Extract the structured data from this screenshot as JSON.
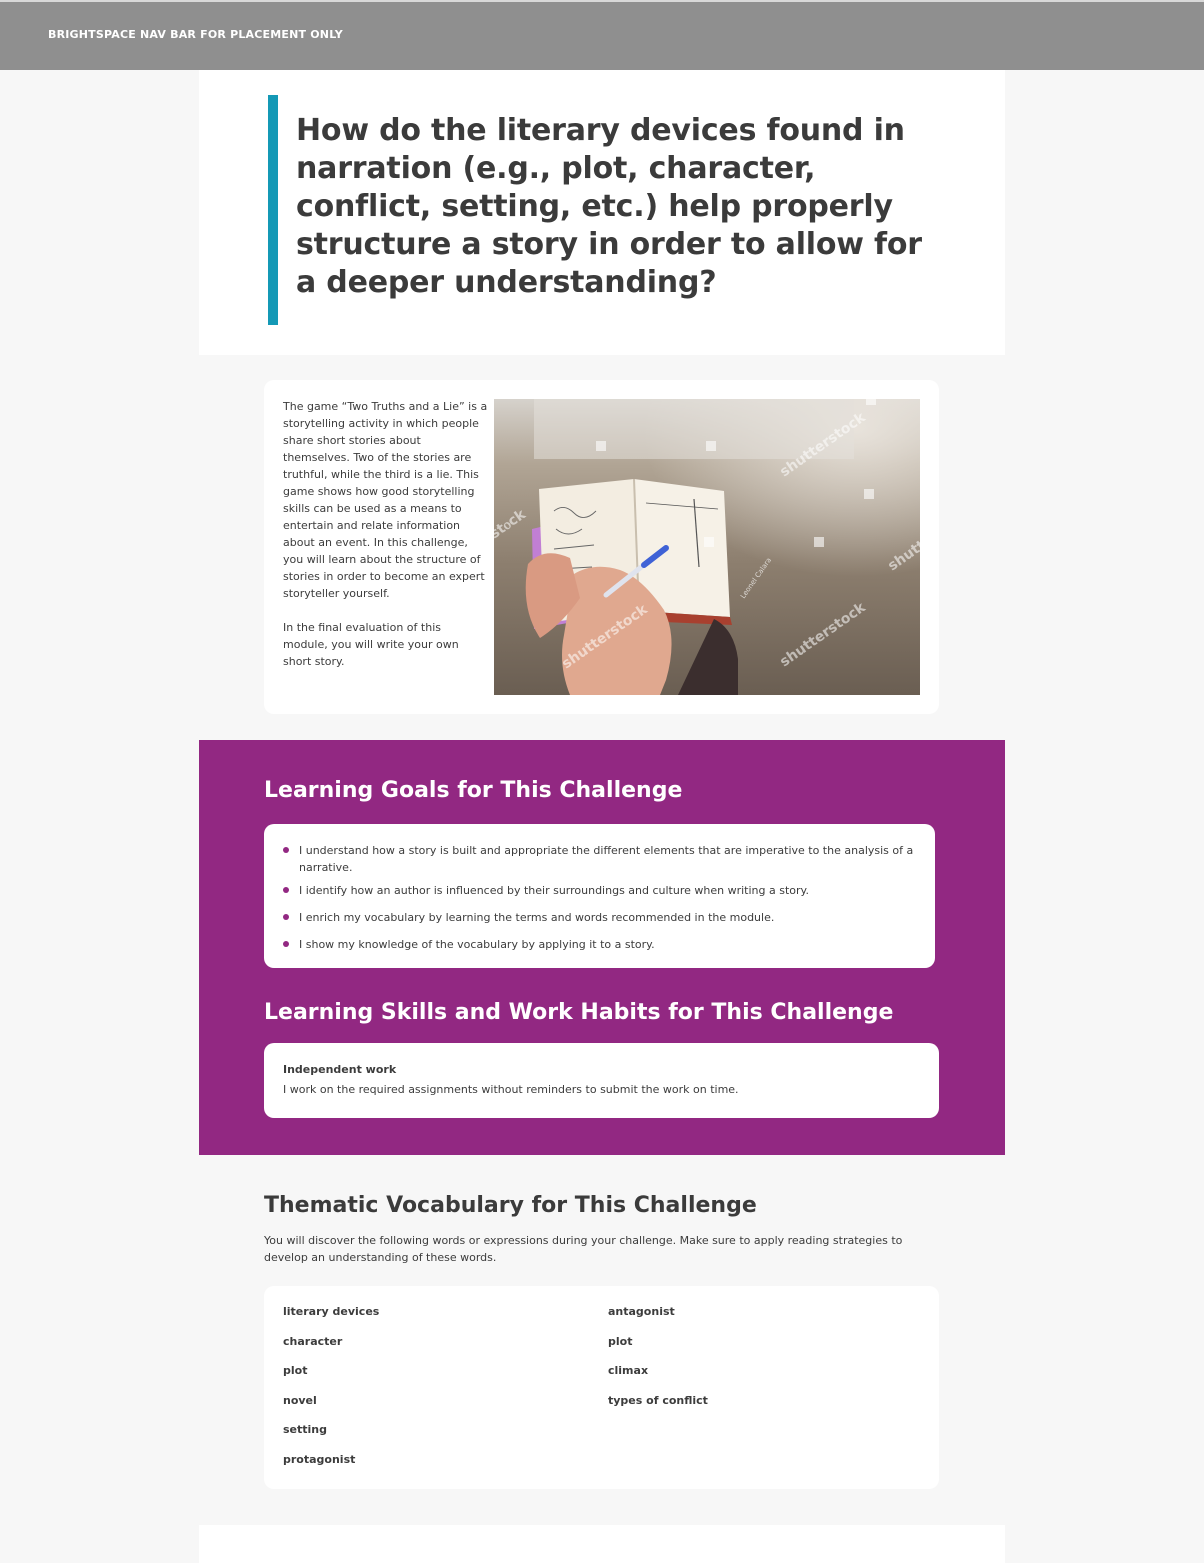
{
  "navbar": {
    "label": "BRIGHTSPACE NAV BAR FOR PLACEMENT ONLY"
  },
  "hero": {
    "title": "How do the literary devices found in narration (e.g., plot, character, conflict, setting, etc.) help properly structure a story in order to allow for a deeper understanding?",
    "accent_color": "#1499b6"
  },
  "intro": {
    "paragraphs": [
      "The game “Two Truths and a Lie” is a storytelling activity in which people share short stories about themselves. Two of the stories are truthful, while the third is a lie. This game shows how good storytelling skills can be used as a means to entertain and relate information about an event. In this challenge, you will learn about the structure of stories in order to become an expert storyteller yourself.",
      "In the final evaluation of this module, you will write your own short story."
    ],
    "image": {
      "description_icon": "photo-icon",
      "watermarks": [
        "shutterstock",
        "shutterstock",
        "shutterstock",
        "stⲟck",
        "shutte"
      ],
      "credit": "Leonel Calara"
    }
  },
  "goals": {
    "title": "Learning Goals for This Challenge",
    "items": [
      "I understand how a story is built and appropriate the different elements that are imperative to the analysis of a narrative.",
      "I identify how an author is influenced by their surroundings and culture when writing a story.",
      "I enrich my vocabulary by learning the terms and words recommended in the module.",
      "I show my knowledge of the vocabulary by applying it to a story."
    ],
    "section_color": "#922882"
  },
  "skills": {
    "title": "Learning Skills and Work Habits for This Challenge",
    "heading": "Independent work",
    "text": "I  work on the required assignments without reminders to submit the work on time."
  },
  "vocab": {
    "title": "Thematic Vocabulary for This Challenge",
    "intro": "You will discover the following words or expressions during your challenge. Make sure to apply reading strategies to develop an understanding of these words.",
    "left": [
      "literary devices",
      "character",
      "plot",
      "novel",
      "setting",
      "protagonist"
    ],
    "right": [
      "antagonist",
      "plot",
      "climax",
      "types of conflict"
    ]
  }
}
